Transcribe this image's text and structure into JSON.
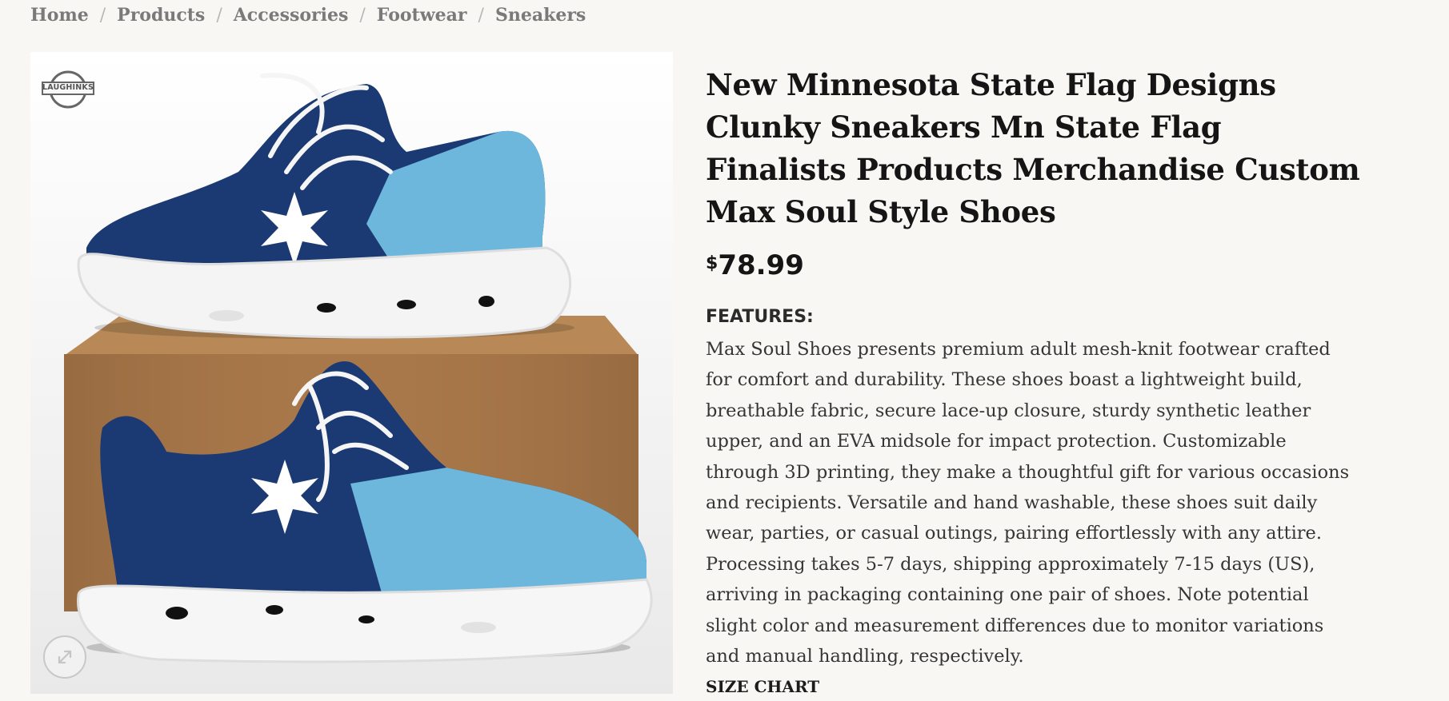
{
  "breadcrumb": {
    "items": [
      "Home",
      "Products",
      "Accessories",
      "Footwear",
      "Sneakers"
    ],
    "separator": "/"
  },
  "gallery": {
    "logo_text": "LAUGHINKS",
    "zoom_icon": "expand-arrows-icon",
    "colors": {
      "navy": "#1b3a73",
      "sky": "#6db7dc",
      "box": "#a8784a"
    }
  },
  "product": {
    "title": "New Minnesota State Flag Designs Clunky Sneakers Mn State Flag Finalists Products Merchandise Custom Max Soul Style Shoes",
    "price_currency": "$",
    "price_amount": "78.99",
    "features_heading": "FEATURES:",
    "description": "Max Soul Shoes presents premium adult mesh-knit footwear crafted for comfort and durability. These shoes boast a lightweight build, breathable fabric, secure lace-up closure, sturdy synthetic leather upper, and an EVA midsole for impact protection. Customizable through 3D printing, they make a thoughtful gift for various occasions and recipients. Versatile and hand washable, these shoes suit daily wear, parties, or casual outings, pairing effortlessly with any attire. Processing takes 5-7 days, shipping approximately 7-15 days (US), arriving in packaging containing one pair of shoes. Note potential slight color and measurement differences due to monitor variations and manual handling, respectively.",
    "size_chart_heading": "SIZE CHART"
  }
}
